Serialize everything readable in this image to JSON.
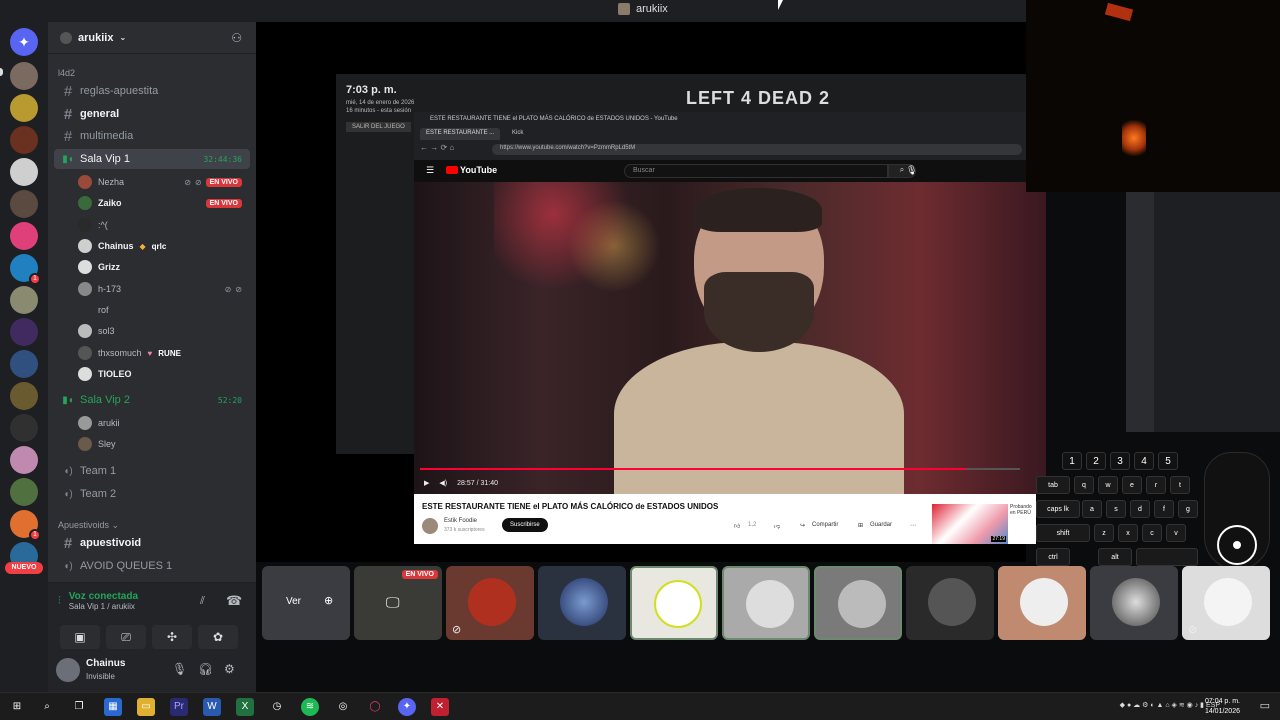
{
  "window": {
    "title": "arukiix"
  },
  "rail": {
    "new_badge": "NUEVO",
    "badge_count": "1"
  },
  "guild": {
    "name": "arukiix"
  },
  "sidebar": {
    "category": "l4d2",
    "channels": [
      {
        "name": "reglas-apuestita"
      },
      {
        "name": "general"
      },
      {
        "name": "multimedia"
      }
    ],
    "voice1": {
      "name": "Sala Vip 1",
      "timer": "32:44:36",
      "members": [
        {
          "name": "Nezha",
          "live": "EN VIVO"
        },
        {
          "name": "Zaiko",
          "live": "EN VIVO"
        },
        {
          "name": ":^("
        },
        {
          "name": "Chainus",
          "tag": "qrlc"
        },
        {
          "name": "Grizz"
        },
        {
          "name": "h-173"
        },
        {
          "name": "rof"
        },
        {
          "name": "sol3"
        },
        {
          "name": "thxsomuch",
          "tag": "RUNE"
        },
        {
          "name": "TIOLEO"
        }
      ]
    },
    "voice2": {
      "name": "Sala Vip 2",
      "timer": "52:20",
      "members": [
        {
          "name": "arukii"
        },
        {
          "name": "Sley"
        }
      ]
    },
    "team1": "Team 1",
    "team2": "Team 2",
    "category2": "Apuestivoids",
    "channel_apuestivoid": "apuestivoid",
    "channel_avoid": "AVOID QUEUES 1"
  },
  "voice_panel": {
    "status": "Voz conectada",
    "location": "Sala Vip 1 / arukiix"
  },
  "user_panel": {
    "name": "Chainus",
    "status": "Invisible"
  },
  "stream": {
    "game": {
      "time": "7:03 p. m.",
      "date": "mié, 14 de enero de 2026",
      "session": "16 minutos - esta sesión",
      "exit": "SALIR DEL JUEGO",
      "logo": "LEFT 4 DEAD 2"
    },
    "browser": {
      "window_title": "ESTE RESTAURANTE TIENE el PLATO MÁS CALÓRICO de ESTADOS UNIDOS - YouTube",
      "tab1": "ESTE RESTAURANTE ...",
      "tab2": "Kick",
      "url": "https://www.youtube.com/watch?v=PzmmRpLd5tM",
      "yt_logo": "YouTube",
      "search_placeholder": "Buscar",
      "time": "28:57 / 31:40",
      "progress": 0.91,
      "video_title": "ESTE RESTAURANTE TIENE el PLATO MÁS CALÓRICO de ESTADOS UNIDOS",
      "channel": "Estik Foodie",
      "subscribers": "373 k suscriptores",
      "subscribe": "Suscribirse",
      "likes": "1,2",
      "share": "Compartir",
      "save": "Guardar",
      "more": "⋯",
      "next_duration": "27:19",
      "next_title": "Probando en PERÚ"
    }
  },
  "tiles": {
    "view": "Ver",
    "live": "EN VIVO"
  },
  "keyboard": {
    "row_nums": [
      "1",
      "2",
      "3",
      "4",
      "5"
    ],
    "row1": [
      "tab",
      "q",
      "w",
      "e",
      "r",
      "t"
    ],
    "row2": [
      "caps lk",
      "a",
      "s",
      "d",
      "f",
      "g"
    ],
    "row3": [
      "shift",
      "z",
      "x",
      "c",
      "v"
    ],
    "row4": [
      "ctrl",
      "alt"
    ]
  },
  "taskbar": {
    "lang": "ESP",
    "time": "07:04 p. m.",
    "date": "14/01/2026"
  }
}
